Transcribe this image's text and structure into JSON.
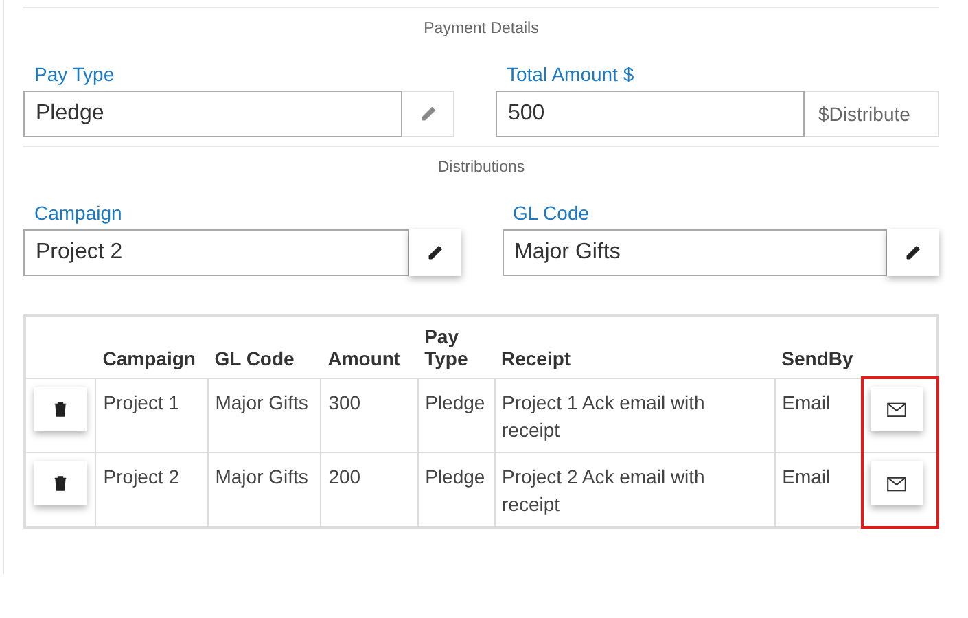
{
  "payment_details": {
    "heading": "Payment Details",
    "fields": [
      {
        "label": "Pay Type",
        "value": "Pledge",
        "addon": {
          "kind": "edit",
          "disabled": true
        }
      },
      {
        "label": "Total Amount $",
        "value": "500",
        "addon": {
          "kind": "text",
          "text": "$Distribute"
        }
      }
    ]
  },
  "distributions": {
    "heading": "Distributions",
    "fields": [
      {
        "label": "Campaign",
        "value": "Project 2",
        "addon": {
          "kind": "edit",
          "disabled": false
        }
      },
      {
        "label": "GL Code",
        "value": "Major Gifts",
        "addon": {
          "kind": "edit",
          "disabled": false
        }
      }
    ],
    "table": {
      "columns": [
        "Campaign",
        "GL Code",
        "Amount",
        "Pay Type",
        "Receipt",
        "SendBy"
      ],
      "rows": [
        {
          "cells": [
            "Project 1",
            "Major Gifts",
            "300",
            "Pledge",
            "Project 1 Ack email with receipt",
            "Email"
          ]
        },
        {
          "cells": [
            "Project 2",
            "Major Gifts",
            "200",
            "Pledge",
            "Project 2 Ack email with receipt",
            "Email"
          ]
        }
      ],
      "send_column_highlighted": true
    }
  }
}
